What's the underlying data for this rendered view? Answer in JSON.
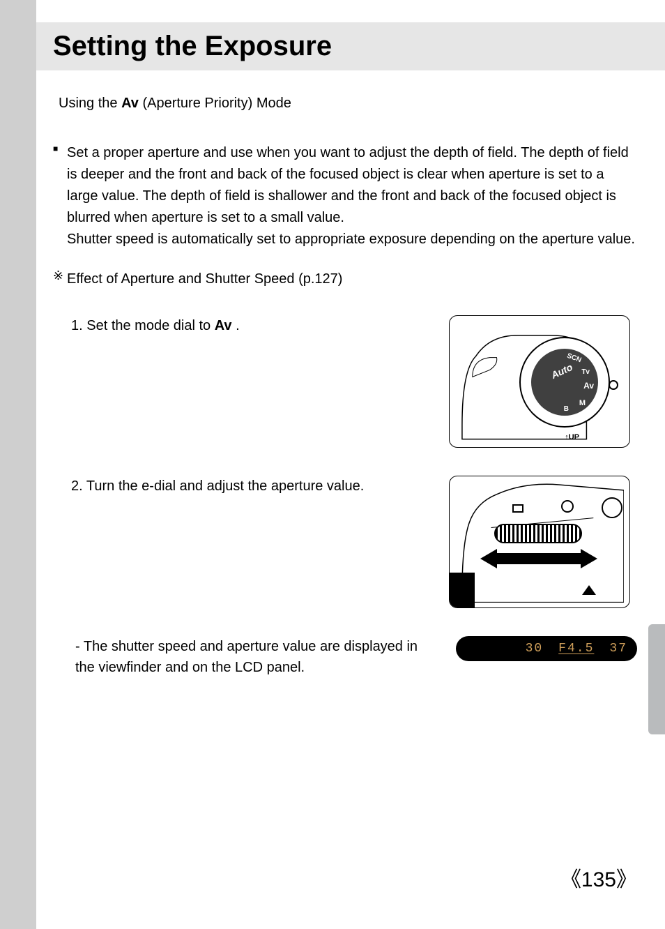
{
  "page": {
    "title": "Setting the Exposure",
    "subtitle_parts": {
      "prefix": "Using the ",
      "mode_symbol": "Av",
      "suffix": " (Aperture Priority) Mode"
    },
    "description": {
      "para1": "Set a proper aperture and use when you want to adjust the depth of field. The depth of field is deeper and the front and back of the focused object is clear when aperture is set to a large value. The depth of field is shallower and the front and back of the focused object is blurred when aperture is set to a small value.",
      "para2": "Shutter speed is automatically set to appropriate exposure depending on the aperture value."
    },
    "reference": "Effect of Aperture and Shutter Speed (p.127)",
    "steps": {
      "step1_parts": {
        "prefix": "1. Set the mode dial to ",
        "mode_symbol": "Av",
        "suffix": " ."
      },
      "step2": "2. Turn the e-dial and adjust the aperture value.",
      "step2_note": "- The shutter speed and aperture value are displayed in the viewfinder and on the LCD panel."
    },
    "viewfinder": {
      "shutter": "30",
      "aperture": "F4.5",
      "count": "37"
    },
    "dial_labels": {
      "auto": "Auto",
      "scn": "SCN",
      "tv": "Tv",
      "av": "Av",
      "m": "M",
      "b": "B",
      "tup": "↑UP"
    },
    "page_number": "《135》"
  }
}
